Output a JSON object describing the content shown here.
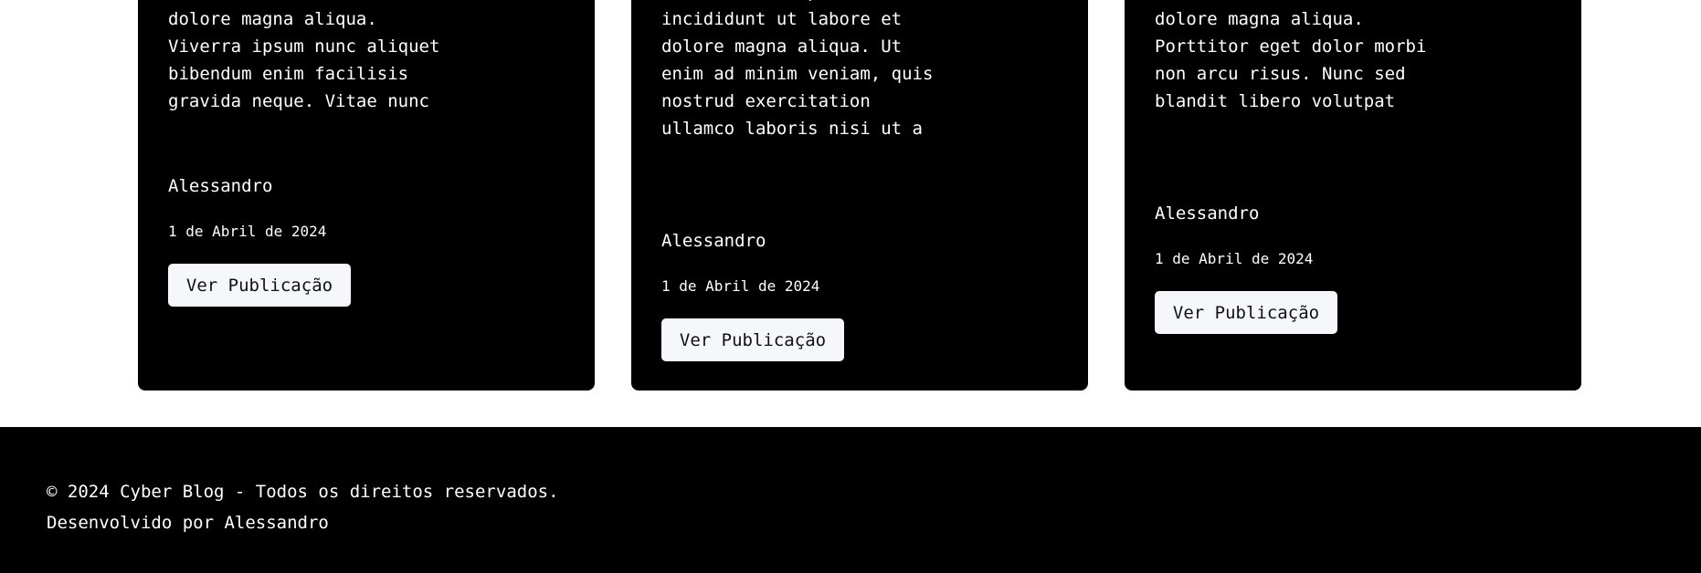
{
  "cards": [
    {
      "excerpt": "incididunt ut labore et dolore magna aliqua. Viverra ipsum nunc aliquet bibendum enim facilisis gravida neque. Vitae nunc",
      "author": "Alessandro",
      "date": "1 de Abril de 2024",
      "button_label": "Ver Publicação"
    },
    {
      "excerpt": "do eiusmod tempor incididunt ut labore et dolore magna aliqua. Ut enim ad minim veniam, quis nostrud exercitation ullamco laboris nisi ut a",
      "author": "Alessandro",
      "date": "1 de Abril de 2024",
      "button_label": "Ver Publicação"
    },
    {
      "excerpt": "incididunt ut labore et dolore magna aliqua. Porttitor eget dolor morbi non arcu risus. Nunc sed blandit libero volutpat",
      "author": "Alessandro",
      "date": "1 de Abril de 2024",
      "button_label": "Ver Publicação"
    }
  ],
  "footer": {
    "copyright": "© 2024 Cyber Blog - Todos os direitos reservados.",
    "developer": "Desenvolvido por Alessandro"
  },
  "colors": {
    "card_background": "#000000",
    "button_background": "#f5f7fa",
    "footer_background": "#000000",
    "text_light": "#ffffff"
  }
}
